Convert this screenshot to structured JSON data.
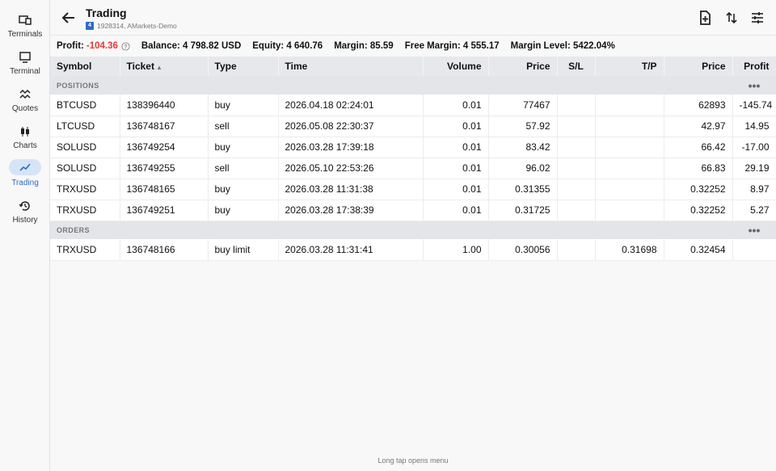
{
  "nav": {
    "items": [
      {
        "label": "Terminals",
        "icon": "terminals-icon"
      },
      {
        "label": "Terminal",
        "icon": "monitor-icon"
      },
      {
        "label": "Quotes",
        "icon": "quotes-icon"
      },
      {
        "label": "Charts",
        "icon": "candlestick-icon"
      },
      {
        "label": "Trading",
        "icon": "trend-icon",
        "active": true
      },
      {
        "label": "History",
        "icon": "history-icon"
      }
    ]
  },
  "header": {
    "title": "Trading",
    "account_badge": "4",
    "account_info": "1928314, AMarkets-Demo"
  },
  "summary": {
    "profit_label": "Profit:",
    "profit_value": "-104.36",
    "balance": "Balance: 4 798.82 USD",
    "equity": "Equity: 4 640.76",
    "margin": "Margin: 85.59",
    "free_margin": "Free Margin: 4 555.17",
    "margin_level": "Margin Level: 5422.04%"
  },
  "table": {
    "columns": [
      "Symbol",
      "Ticket",
      "Type",
      "Time",
      "Volume",
      "Price",
      "S/L",
      "T/P",
      "Price",
      "Profit"
    ],
    "sort_indicator": "▲",
    "positions_label": "POSITIONS",
    "orders_label": "ORDERS",
    "section_menu": "•••",
    "positions": [
      {
        "symbol": "BTCUSD",
        "ticket": "138396440",
        "type": "buy",
        "time": "2026.04.18 02:24:01",
        "volume": "0.01",
        "price": "77467",
        "sl": "",
        "tp": "",
        "current": "62893",
        "profit": "-145.74"
      },
      {
        "symbol": "LTCUSD",
        "ticket": "136748167",
        "type": "sell",
        "time": "2026.05.08 22:30:37",
        "volume": "0.01",
        "price": "57.92",
        "sl": "",
        "tp": "",
        "current": "42.97",
        "profit": "14.95"
      },
      {
        "symbol": "SOLUSD",
        "ticket": "136749254",
        "type": "buy",
        "time": "2026.03.28 17:39:18",
        "volume": "0.01",
        "price": "83.42",
        "sl": "",
        "tp": "",
        "current": "66.42",
        "profit": "-17.00"
      },
      {
        "symbol": "SOLUSD",
        "ticket": "136749255",
        "type": "sell",
        "time": "2026.05.10 22:53:26",
        "volume": "0.01",
        "price": "96.02",
        "sl": "",
        "tp": "",
        "current": "66.83",
        "profit": "29.19"
      },
      {
        "symbol": "TRXUSD",
        "ticket": "136748165",
        "type": "buy",
        "time": "2026.03.28 11:31:38",
        "volume": "0.01",
        "price": "0.31355",
        "sl": "",
        "tp": "",
        "current": "0.32252",
        "profit": "8.97"
      },
      {
        "symbol": "TRXUSD",
        "ticket": "136749251",
        "type": "buy",
        "time": "2026.03.28 17:38:39",
        "volume": "0.01",
        "price": "0.31725",
        "sl": "",
        "tp": "",
        "current": "0.32252",
        "profit": "5.27"
      }
    ],
    "orders": [
      {
        "symbol": "TRXUSD",
        "ticket": "136748166",
        "type": "buy limit",
        "time": "2026.03.28 11:31:41",
        "volume": "1.00",
        "price": "0.30056",
        "sl": "",
        "tp": "0.31698",
        "current": "0.32454",
        "profit": ""
      }
    ]
  },
  "footer_hint": "Long tap opens menu",
  "colors": {
    "accent": "#2b6cc4",
    "negative": "#e53935",
    "positive": "#2ea043"
  }
}
